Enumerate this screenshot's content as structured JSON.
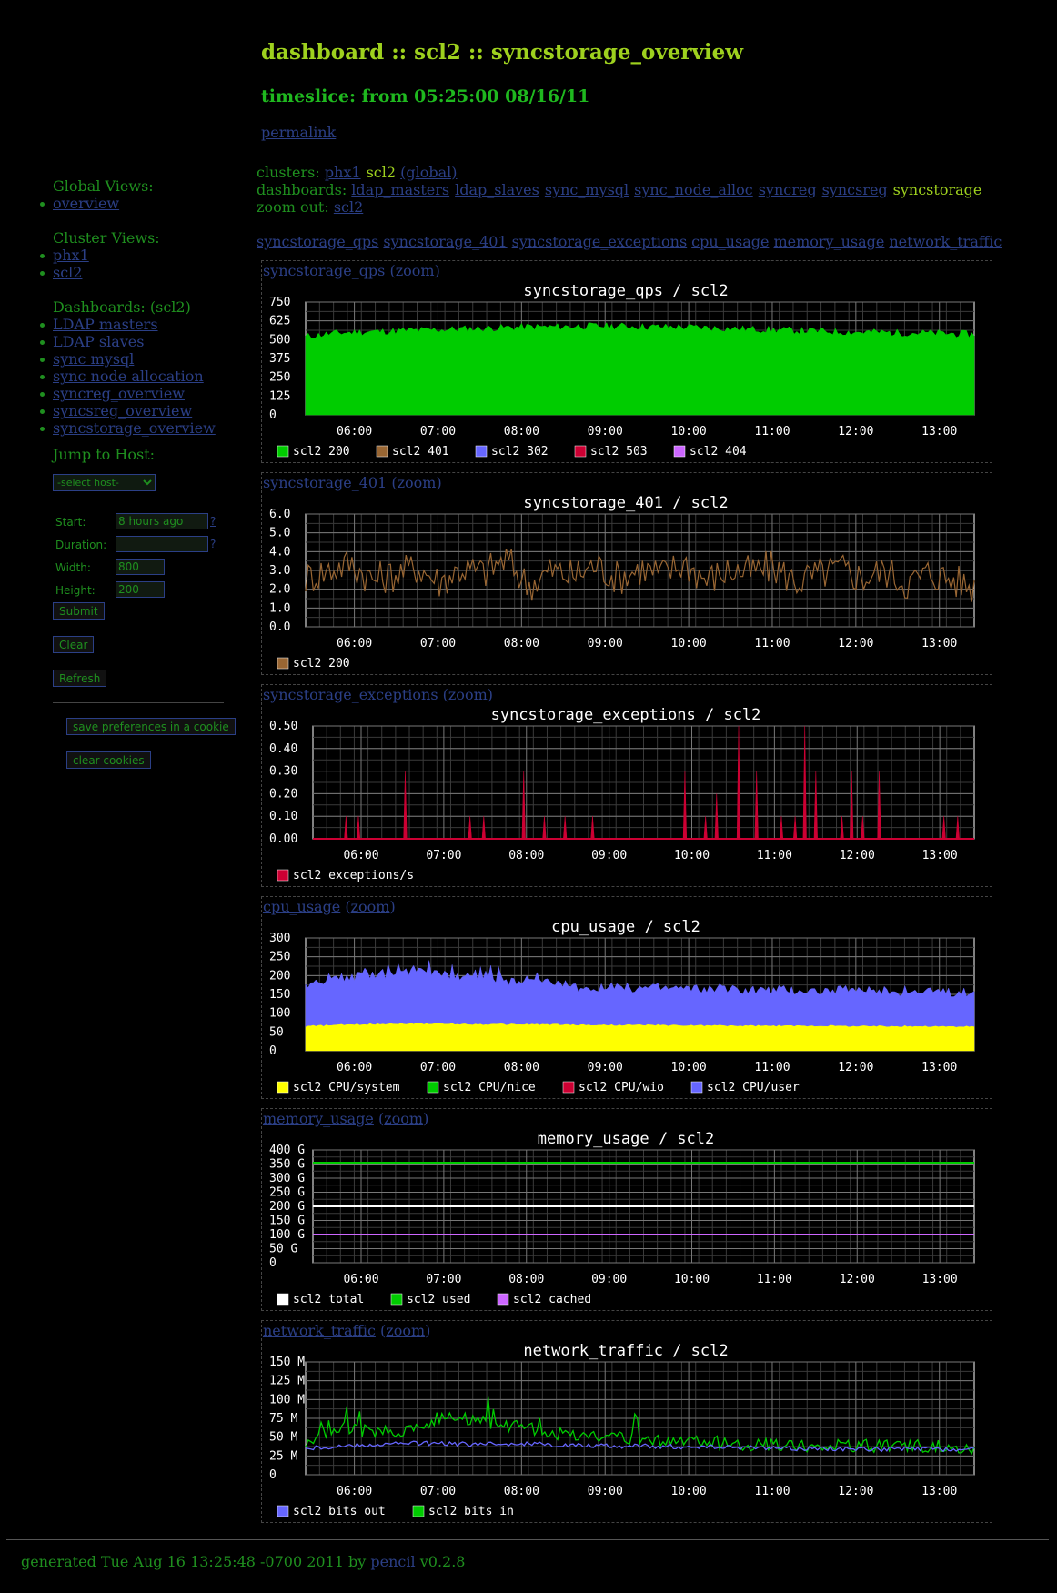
{
  "header": {
    "title": "dashboard :: scl2 :: syncstorage_overview",
    "timeslice": "timeslice: from 05:25:00 08/16/11",
    "permalink": "permalink"
  },
  "nav": {
    "clusters_label": "clusters:",
    "cluster_phx1": "phx1",
    "cluster_current": "scl2",
    "cluster_global": "(global)",
    "dashboards_label": "dashboards:",
    "dashboards": [
      "ldap_masters",
      "ldap_slaves",
      "sync_mysql",
      "sync_node_alloc",
      "syncreg",
      "syncsreg"
    ],
    "dashboard_current": "syncstorage",
    "zoomout_label": "zoom out:",
    "zoomout_link": "scl2",
    "graphs": [
      "syncstorage_qps",
      "syncstorage_401",
      "syncstorage_exceptions",
      "cpu_usage",
      "memory_usage",
      "network_traffic"
    ]
  },
  "sidebar": {
    "global_heading": "Global Views:",
    "global_items": [
      "overview"
    ],
    "cluster_heading": "Cluster Views:",
    "cluster_items": [
      "phx1",
      "scl2"
    ],
    "dashboards_heading": "Dashboards: (scl2)",
    "dashboard_items": [
      "LDAP masters",
      "LDAP slaves",
      "sync mysql",
      "sync node allocation",
      "syncreg_overview",
      "syncsreg_overview",
      "syncstorage_overview"
    ],
    "jump_heading": "Jump to Host:",
    "host_select": "-select host-",
    "form": {
      "start_label": "Start:",
      "start_value": "8 hours ago",
      "duration_label": "Duration:",
      "duration_value": "",
      "width_label": "Width:",
      "width_value": "800",
      "height_label": "Height:",
      "height_value": "200",
      "help": "?"
    },
    "submit": "Submit",
    "clear": "Clear",
    "refresh": "Refresh",
    "save_prefs": "save preferences in a cookie",
    "clear_cookies": "clear cookies"
  },
  "zoom_label": "zoom",
  "footer": {
    "prefix": "generated Tue Aug 16 13:25:48 -0700 2011 by",
    "link": "pencil",
    "suffix": "v0.2.8"
  },
  "chart_data": [
    {
      "id": "syncstorage_qps",
      "type": "area",
      "title": "syncstorage_qps / scl2",
      "x_ticks": [
        "06:00",
        "07:00",
        "08:00",
        "09:00",
        "10:00",
        "11:00",
        "12:00",
        "13:00"
      ],
      "y_ticks": [
        "750",
        "625",
        "500",
        "375",
        "250",
        "125",
        "0"
      ],
      "ylim": [
        0,
        750
      ],
      "grid": true,
      "series": [
        {
          "name": "scl2 200",
          "color": "#00cc00",
          "values": [
            520,
            540,
            550,
            555,
            560,
            565,
            570,
            575,
            580,
            585,
            585,
            590,
            590,
            590,
            585,
            585,
            580,
            575,
            570,
            565,
            560,
            555,
            550,
            550,
            545,
            545,
            540,
            535
          ]
        },
        {
          "name": "scl2 401",
          "color": "#996633",
          "values": []
        },
        {
          "name": "scl2 302",
          "color": "#6666ff",
          "values": []
        },
        {
          "name": "scl2 503",
          "color": "#cc0033",
          "values": []
        },
        {
          "name": "scl2 404",
          "color": "#cc66ff",
          "values": []
        }
      ]
    },
    {
      "id": "syncstorage_401",
      "type": "line",
      "title": "syncstorage_401 / scl2",
      "x_ticks": [
        "06:00",
        "07:00",
        "08:00",
        "09:00",
        "10:00",
        "11:00",
        "12:00",
        "13:00"
      ],
      "y_ticks": [
        "6.0",
        "5.0",
        "4.0",
        "3.0",
        "2.0",
        "1.0",
        "0.0"
      ],
      "ylim": [
        0,
        6
      ],
      "grid": true,
      "series": [
        {
          "name": "scl2 200",
          "color": "#996633",
          "values": [
            2.6,
            3.0,
            3.4,
            2.5,
            2.8,
            3.2,
            2.4,
            3.1,
            2.9,
            3.6,
            2.2,
            3.0,
            2.7,
            3.3,
            2.6,
            3.1,
            2.8,
            3.4,
            2.5,
            3.0,
            2.9,
            3.2,
            2.4,
            2.8,
            3.1,
            2.6,
            3.0,
            2.3,
            2.9,
            2.5,
            2.1
          ]
        }
      ]
    },
    {
      "id": "syncstorage_exceptions",
      "type": "bar",
      "title": "syncstorage_exceptions / scl2",
      "x_ticks": [
        "06:00",
        "07:00",
        "08:00",
        "09:00",
        "10:00",
        "11:00",
        "12:00",
        "13:00"
      ],
      "y_ticks": [
        "0.50",
        "0.40",
        "0.30",
        "0.20",
        "0.10",
        "0.00"
      ],
      "ylim": [
        0,
        0.5
      ],
      "grid": true,
      "series": [
        {
          "name": "scl2 exceptions/s",
          "color": "#cc0033",
          "values": []
        }
      ],
      "spikes": [
        {
          "t": "05:49",
          "y": 0.1
        },
        {
          "t": "05:58",
          "y": 0.1
        },
        {
          "t": "06:32",
          "y": 0.3
        },
        {
          "t": "07:19",
          "y": 0.1
        },
        {
          "t": "07:29",
          "y": 0.1
        },
        {
          "t": "07:58",
          "y": 0.3
        },
        {
          "t": "08:13",
          "y": 0.1
        },
        {
          "t": "08:28",
          "y": 0.1
        },
        {
          "t": "08:48",
          "y": 0.1
        },
        {
          "t": "09:55",
          "y": 0.3
        },
        {
          "t": "10:10",
          "y": 0.1
        },
        {
          "t": "10:18",
          "y": 0.2
        },
        {
          "t": "10:34",
          "y": 0.5
        },
        {
          "t": "10:47",
          "y": 0.3
        },
        {
          "t": "11:05",
          "y": 0.1
        },
        {
          "t": "11:15",
          "y": 0.1
        },
        {
          "t": "11:22",
          "y": 0.5
        },
        {
          "t": "11:30",
          "y": 0.3
        },
        {
          "t": "11:49",
          "y": 0.1
        },
        {
          "t": "11:56",
          "y": 0.3
        },
        {
          "t": "12:04",
          "y": 0.1
        },
        {
          "t": "12:16",
          "y": 0.3
        },
        {
          "t": "13:03",
          "y": 0.1
        },
        {
          "t": "13:13",
          "y": 0.1
        }
      ]
    },
    {
      "id": "cpu_usage",
      "type": "area",
      "title": "cpu_usage / scl2",
      "x_ticks": [
        "06:00",
        "07:00",
        "08:00",
        "09:00",
        "10:00",
        "11:00",
        "12:00",
        "13:00"
      ],
      "y_ticks": [
        "300",
        "250",
        "200",
        "150",
        "100",
        "50",
        "0"
      ],
      "ylim": [
        0,
        300
      ],
      "grid": true,
      "stacked": true,
      "series": [
        {
          "name": "scl2 CPU/system",
          "color": "#ffff00",
          "values": [
            65,
            68,
            70,
            72,
            72,
            71,
            70,
            70,
            70,
            69,
            68,
            68,
            68,
            67,
            67,
            66,
            66,
            66,
            66,
            65,
            65,
            65,
            64,
            64
          ]
        },
        {
          "name": "scl2 CPU/nice",
          "color": "#00cc00",
          "values": []
        },
        {
          "name": "scl2 CPU/wio",
          "color": "#cc0033",
          "values": []
        },
        {
          "name": "scl2 CPU/user",
          "color": "#6666ff",
          "values": [
            105,
            120,
            130,
            135,
            140,
            130,
            125,
            115,
            110,
            105,
            100,
            100,
            100,
            100,
            98,
            98,
            97,
            96,
            95,
            95,
            94,
            93,
            92,
            90
          ]
        }
      ]
    },
    {
      "id": "memory_usage",
      "type": "line",
      "title": "memory_usage / scl2",
      "x_ticks": [
        "06:00",
        "07:00",
        "08:00",
        "09:00",
        "10:00",
        "11:00",
        "12:00",
        "13:00"
      ],
      "y_ticks": [
        "400 G",
        "350 G",
        "300 G",
        "250 G",
        "200 G",
        "150 G",
        "100 G",
        "50 G",
        "0"
      ],
      "ylim": [
        0,
        400
      ],
      "grid": true,
      "series": [
        {
          "name": "scl2 total",
          "color": "#ffffff",
          "values": [
            200,
            200
          ]
        },
        {
          "name": "scl2 used",
          "color": "#00cc00",
          "values": [
            355,
            355
          ]
        },
        {
          "name": "scl2 cached",
          "color": "#cc66ff",
          "values": [
            100,
            100
          ]
        }
      ]
    },
    {
      "id": "network_traffic",
      "type": "line",
      "title": "network_traffic / scl2",
      "x_ticks": [
        "06:00",
        "07:00",
        "08:00",
        "09:00",
        "10:00",
        "11:00",
        "12:00",
        "13:00"
      ],
      "y_ticks": [
        "150 M",
        "125 M",
        "100 M",
        "75 M",
        "50 M",
        "25 M",
        "0"
      ],
      "ylim": [
        0,
        150
      ],
      "grid": true,
      "series": [
        {
          "name": "scl2 bits out",
          "color": "#6666ff",
          "values": [
            35,
            38,
            40,
            42,
            41,
            40,
            42,
            40,
            39,
            38,
            38,
            37,
            36,
            36,
            35,
            35,
            34,
            34,
            34,
            33
          ]
        },
        {
          "name": "scl2 bits in",
          "color": "#00cc00",
          "values": [
            45,
            65,
            55,
            60,
            80,
            70,
            65,
            55,
            50,
            48,
            45,
            44,
            42,
            40,
            40,
            38,
            38,
            38,
            37,
            36
          ]
        }
      ]
    }
  ]
}
